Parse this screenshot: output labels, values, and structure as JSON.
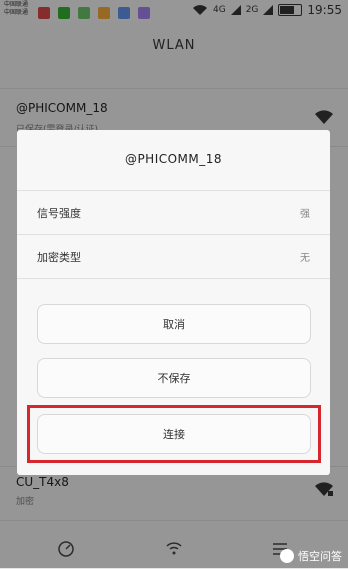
{
  "status_bar": {
    "carrier_line1": "中国联通",
    "carrier_line2": "中国联通",
    "network_a": "4G",
    "network_b": "2G",
    "time": "19:55"
  },
  "title": "WLAN",
  "networks": [
    {
      "name": "@PHICOMM_18",
      "status": "已保存(需登录/认证)"
    },
    {
      "name": "CU_T4x8",
      "status": "加密"
    }
  ],
  "dialog": {
    "title": "@PHICOMM_18",
    "rows": [
      {
        "label": "信号强度",
        "value": "强"
      },
      {
        "label": "加密类型",
        "value": "无"
      }
    ],
    "buttons": {
      "cancel": "取消",
      "forget": "不保存",
      "connect": "连接"
    }
  },
  "watermark": "悟空问答",
  "colors": {
    "highlight": "#d8262e"
  }
}
